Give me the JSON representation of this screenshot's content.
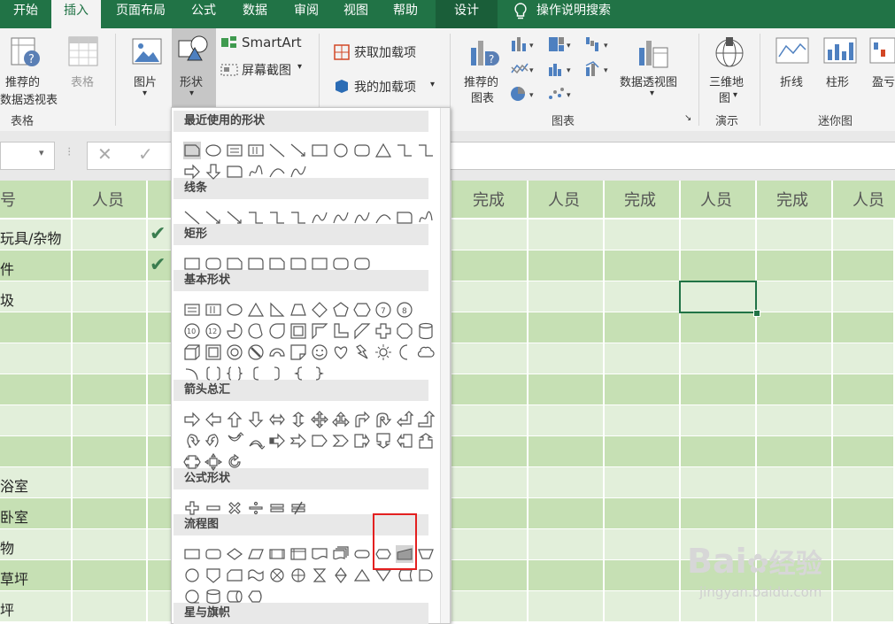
{
  "tabs": [
    "开始",
    "插入",
    "页面布局",
    "公式",
    "数据",
    "审阅",
    "视图",
    "帮助",
    "设计"
  ],
  "tell_me": "操作说明搜索",
  "ribbon": {
    "recommended_pivot": [
      "推荐的",
      "数据透视表"
    ],
    "table": "表格",
    "picture": "图片",
    "shapes": "形状",
    "smartart": "SmartArt",
    "screenshot": "屏幕截图",
    "get_addins": "获取加载项",
    "my_addins": "我的加载项",
    "recommended_charts": [
      "推荐的",
      "图表"
    ],
    "pivot_chart": "数据透视图",
    "map3d": [
      "三维地",
      "图"
    ],
    "spark_line": "折线",
    "spark_column": "柱形",
    "spark_winloss": "盈亏",
    "group_tables": "表格",
    "group_charts": "图表",
    "group_tours": "演示",
    "group_sparklines": "迷你图"
  },
  "grid": {
    "headers": [
      "号",
      "人员",
      "完成",
      "人员",
      "完成",
      "人员",
      "完成",
      "人员"
    ],
    "rows": [
      "玩具/杂物",
      "件",
      "圾",
      "",
      "",
      "",
      "",
      "",
      "浴室",
      "卧室",
      "物",
      "草坪",
      "坪"
    ],
    "checks": [
      true,
      true
    ]
  },
  "menu": {
    "sections": [
      "最近使用的形状",
      "线条",
      "矩形",
      "基本形状",
      "箭头总汇",
      "公式形状",
      "流程图",
      "星与旗帜"
    ]
  },
  "watermark": {
    "brand": "Bai",
    "brand2": "经验",
    "url": "jingyan.baidu.com"
  },
  "colors": {
    "excel_green": "#217346",
    "row_a": "#c6e0b4",
    "row_b": "#e2efda",
    "highlight": "#e32020"
  }
}
